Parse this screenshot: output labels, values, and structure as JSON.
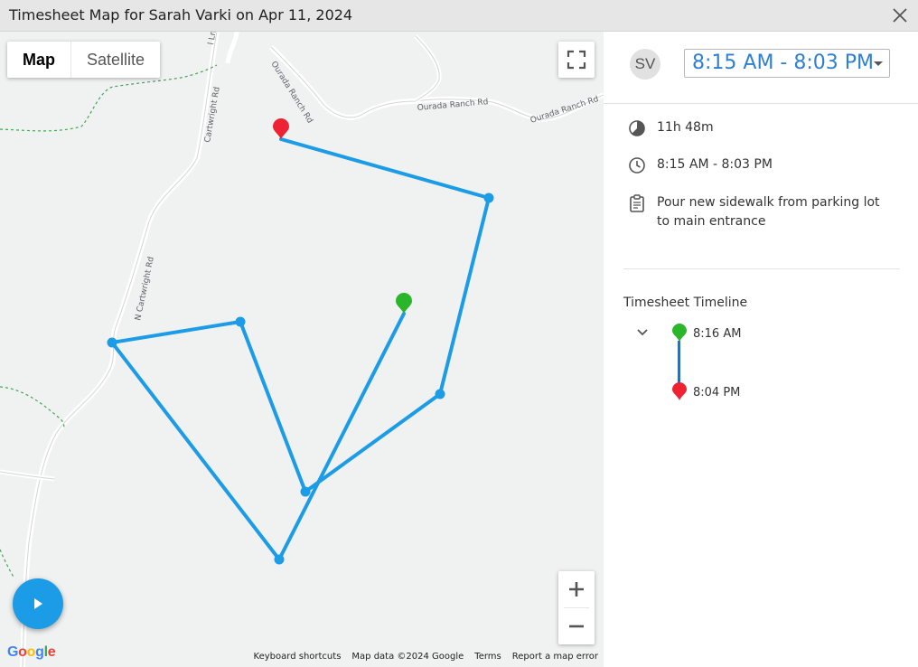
{
  "window": {
    "title": "Timesheet Map for Sarah Varki on Apr 11, 2024"
  },
  "map": {
    "type_buttons": [
      {
        "label": "Map",
        "active": true
      },
      {
        "label": "Satellite",
        "active": false
      }
    ],
    "road_labels": [
      "Cartwright Rd",
      "N Cartwright Rd",
      "Ourada Ranch Rd",
      "Ourada Ranch Rd",
      "Ourada Ranch Rd",
      "l Ln"
    ],
    "route_color": "#1c9be6",
    "start_pin_color": "#2ab52a",
    "end_pin_color": "#ee2233",
    "google_logo": [
      {
        "ch": "G",
        "color": "#4285F4"
      },
      {
        "ch": "o",
        "color": "#EA4335"
      },
      {
        "ch": "o",
        "color": "#FBBC05"
      },
      {
        "ch": "g",
        "color": "#4285F4"
      },
      {
        "ch": "l",
        "color": "#34A853"
      },
      {
        "ch": "e",
        "color": "#EA4335"
      }
    ],
    "attribution": {
      "shortcuts": "Keyboard shortcuts",
      "data": "Map data ©2024 Google",
      "terms": "Terms",
      "report": "Report a map error"
    },
    "icons": {
      "fullscreen": "fullscreen-icon",
      "zoom_in": "plus-icon",
      "zoom_out": "minus-icon",
      "play": "play-icon"
    }
  },
  "panel": {
    "avatar_initials": "SV",
    "time_range_select": "8:15 AM - 8:03 PM",
    "duration": "11h 48m",
    "time_range": "8:15 AM - 8:03 PM",
    "task": "Pour new sidewalk from parking lot to main entrance",
    "timeline": {
      "title": "Timesheet Timeline",
      "start_time": "8:16 AM",
      "end_time": "8:04 PM"
    }
  }
}
